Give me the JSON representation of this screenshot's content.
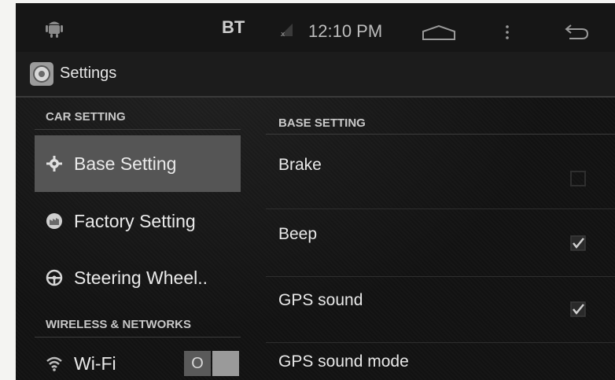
{
  "status_bar": {
    "bt_label": "BT",
    "time": "12:10 PM",
    "icons": [
      "android-icon",
      "signal-icon",
      "home-icon",
      "menu-icon",
      "back-icon"
    ]
  },
  "action_bar": {
    "title": "Settings",
    "icon": "settings-app-icon"
  },
  "left_pane": {
    "sections": [
      {
        "header": "CAR SETTING",
        "items": [
          {
            "label": "Base Setting",
            "icon": "gear-icon",
            "selected": true
          },
          {
            "label": "Factory Setting",
            "icon": "factory-icon",
            "selected": false
          },
          {
            "label": "Steering Wheel..",
            "icon": "steering-wheel-icon",
            "selected": false
          }
        ]
      },
      {
        "header": "WIRELESS & NETWORKS",
        "items": [
          {
            "label": "Wi-Fi",
            "icon": "wifi-icon",
            "selected": false,
            "toggle_label": "O",
            "toggle_on": false
          }
        ]
      }
    ]
  },
  "right_pane": {
    "header": "BASE SETTING",
    "preferences": [
      {
        "label": "Brake",
        "checked": false
      },
      {
        "label": "Beep",
        "checked": true
      },
      {
        "label": "GPS sound",
        "checked": true
      },
      {
        "label": "GPS sound mode"
      }
    ]
  },
  "colors": {
    "screen_bg": "#121212",
    "selected_item_bg": "#555555",
    "text_primary": "#e8e8e8",
    "text_header": "#c8c8c8"
  }
}
